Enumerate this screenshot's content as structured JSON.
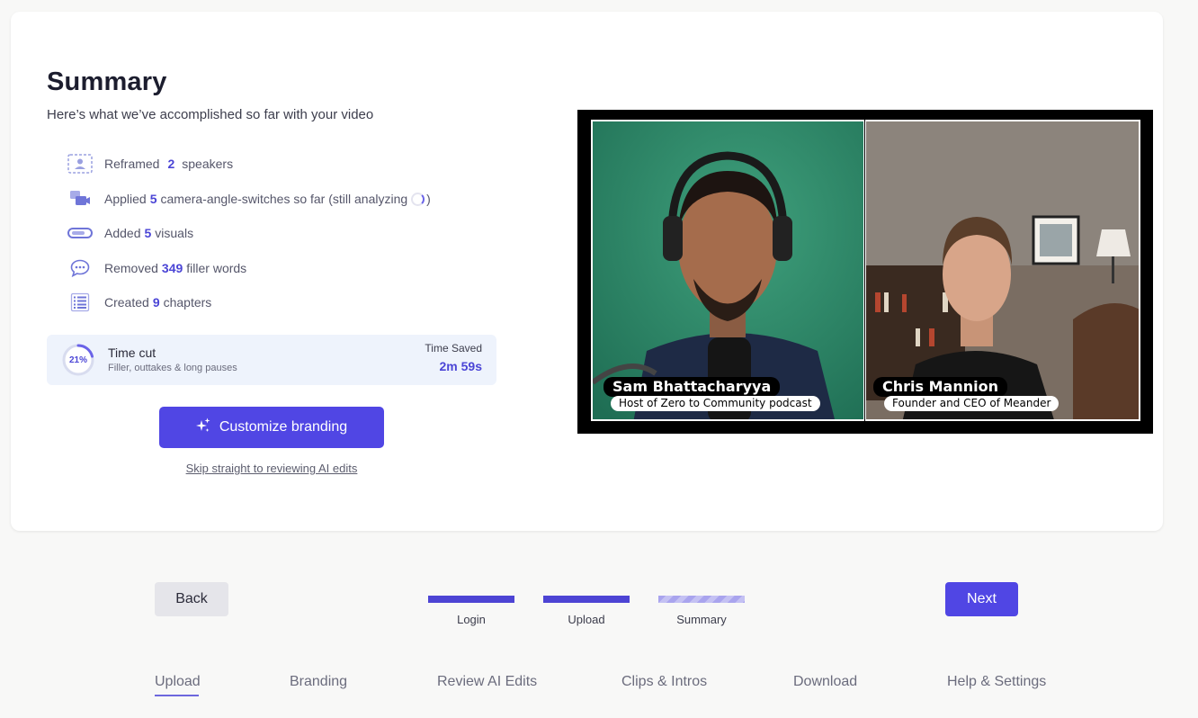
{
  "summary": {
    "title": "Summary",
    "subtitle": "Here’s what we’ve accomplished so far with your video",
    "stats": [
      {
        "icon": "reframe-person-icon",
        "pre": "Reframed",
        "num": "2",
        "post": "speakers"
      },
      {
        "icon": "camera-switch-icon",
        "pre": "Applied",
        "num": "5",
        "post": "camera-angle-switches so far (still analyzing",
        "tail": ")"
      },
      {
        "icon": "visuals-bar-icon",
        "pre": "Added",
        "num": "5",
        "post": "visuals"
      },
      {
        "icon": "speech-bubble-icon",
        "pre": "Removed",
        "num": "349",
        "post": "filler words"
      },
      {
        "icon": "chapters-list-icon",
        "pre": "Created",
        "num": "9",
        "post": "chapters"
      }
    ],
    "time_cut": {
      "percent_label": "21%",
      "percent_value": 21,
      "title": "Time cut",
      "subtitle": "Filler, outtakes & long pauses",
      "saved_label": "Time Saved",
      "saved_value": "2m 59s"
    },
    "customize_button": "Customize branding",
    "skip_link": "Skip straight to reviewing AI edits"
  },
  "video": {
    "left": {
      "name": "Sam Bhattacharyya",
      "role": "Host of Zero to Community podcast"
    },
    "right": {
      "name": "Chris Mannion",
      "role": "Founder and CEO of Meander"
    }
  },
  "wizard": {
    "back_label": "Back",
    "next_label": "Next",
    "steps": [
      {
        "label": "Login",
        "state": "done"
      },
      {
        "label": "Upload",
        "state": "done"
      },
      {
        "label": "Summary",
        "state": "current"
      }
    ]
  },
  "bottom_nav": {
    "items": [
      "Upload",
      "Branding",
      "Review AI Edits",
      "Clips & Intros",
      "Download",
      "Help & Settings"
    ],
    "active": "Upload"
  },
  "colors": {
    "accent": "#5046e4",
    "accent_text": "#4b45d6",
    "panel_bg": "#eef3fc",
    "green_screen": "#2d8a6a"
  }
}
